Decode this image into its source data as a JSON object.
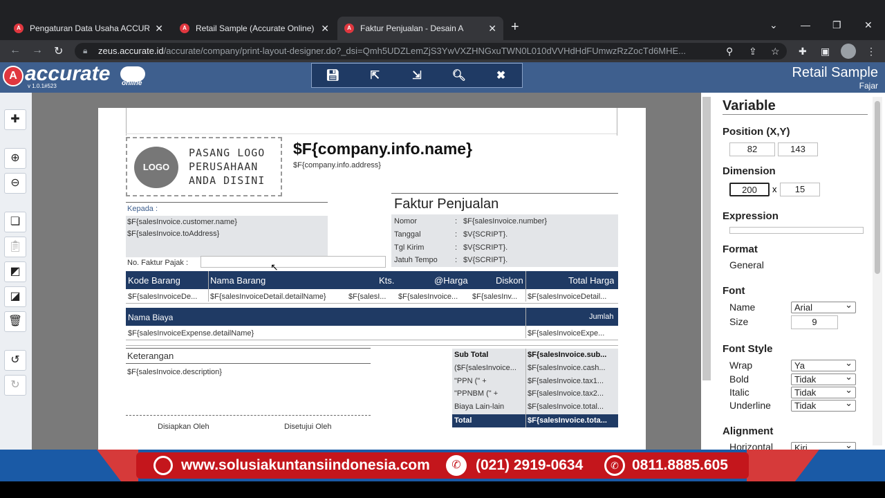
{
  "browser": {
    "tabs": [
      {
        "title": "Pengaturan Data Usaha ACCURATE"
      },
      {
        "title": "Retail Sample (Accurate Online)"
      },
      {
        "title": "Faktur Penjualan - Desain A"
      }
    ],
    "url_domain": "zeus.accurate.id",
    "url_path": "/accurate/company/print-layout-designer.do?_dsi=Qmh5UDZLemZjS3YwVXZHNGxuTWN0L010dVVHdHdFUmwzRzZocTd6MHE..."
  },
  "app": {
    "logo_text": "accurate",
    "logo_sub": "online",
    "version": "v 1.0.1#523",
    "company_name": "Retail Sample",
    "user": "Fajar"
  },
  "document": {
    "logo_circle": "LOGO",
    "logo_placeholder": [
      "PASANG LOGO",
      "PERUSAHAAN",
      "ANDA DISINI"
    ],
    "company_name": "$F{company.info.name}",
    "company_address": "$F{company.info.address}",
    "kepada": "Kepada :",
    "customer_name": "$F{salesInvoice.customer.name}",
    "to_address": "$F{salesInvoice.toAddress}",
    "no_faktur_pajak": "No. Faktur Pajak :",
    "title": "Faktur Penjualan",
    "info_rows": [
      {
        "label": "Nomor",
        "sep": ":",
        "value": "$F{salesInvoice.number}"
      },
      {
        "label": "Tanggal",
        "sep": ":",
        "value": "$V{SCRIPT}."
      },
      {
        "label": "Tgl Kirim",
        "sep": ":",
        "value": "$V{SCRIPT}."
      },
      {
        "label": "Jatuh Tempo",
        "sep": ":",
        "value": "$V{SCRIPT}."
      }
    ],
    "item_headers": [
      "Kode Barang",
      "Nama Barang",
      "Kts.",
      "@Harga",
      "Diskon",
      "Total Harga"
    ],
    "item_cells": [
      "$F{salesInvoiceDe...",
      "$F{salesInvoiceDetail.detailName}",
      "$F{salesI...",
      "$F{salesInvoice...",
      "$F{salesInv...",
      "$F{salesInvoiceDetail..."
    ],
    "expense_headers": [
      "Nama Biaya",
      "Jumlah"
    ],
    "expense_cells": [
      "$F{salesInvoiceExpense.detailName}",
      "$F{salesInvoiceExpe..."
    ],
    "keterangan": "Keterangan",
    "description": "$F{salesInvoice.description}",
    "totals": [
      {
        "label": "Sub Total",
        "value": "$F{salesInvoice.sub..."
      },
      {
        "label": "($F{salesInvoice...",
        "value": "$F{salesInvoice.cash..."
      },
      {
        "label": "\"PPN (\" +",
        "value": "$F{salesInvoice.tax1..."
      },
      {
        "label": "\"PPNBM (\" +",
        "value": "$F{salesInvoice.tax2..."
      },
      {
        "label": "Biaya Lain-lain",
        "value": "$F{salesInvoice.total..."
      },
      {
        "label": "Total",
        "value": "$F{salesInvoice.tota..."
      }
    ],
    "disiapkan": "Disiapkan Oleh",
    "disetujui": "Disetujui Oleh"
  },
  "panel": {
    "title": "Variable",
    "position_label": "Position (X,Y)",
    "pos_x": "82",
    "pos_y": "143",
    "pos_sep": ",",
    "dimension_label": "Dimension",
    "dim_w": "200",
    "dim_h": "15",
    "dim_sep": "x",
    "expression_label": "Expression",
    "format_label": "Format",
    "format_value": "General",
    "font_label": "Font",
    "font_name_label": "Name",
    "font_name": "Arial",
    "font_size_label": "Size",
    "font_size": "9",
    "font_style_label": "Font Style",
    "wrap_label": "Wrap",
    "wrap": "Ya",
    "bold_label": "Bold",
    "bold": "Tidak",
    "italic_label": "Italic",
    "italic": "Tidak",
    "underline_label": "Underline",
    "underline": "Tidak",
    "alignment_label": "Alignment",
    "horizontal_label": "Horizontal",
    "horizontal": "Kiri"
  },
  "banner": {
    "website": "www.solusiakuntansiindonesia.com",
    "phone": "(021) 2919-0634",
    "whatsapp": "0811.8885.605"
  },
  "colors": {
    "header_blue": "#1f3a64",
    "app_bar": "#3e5f8e",
    "banner_red": "#c4161c",
    "banner_blue": "#1a5aa6"
  }
}
